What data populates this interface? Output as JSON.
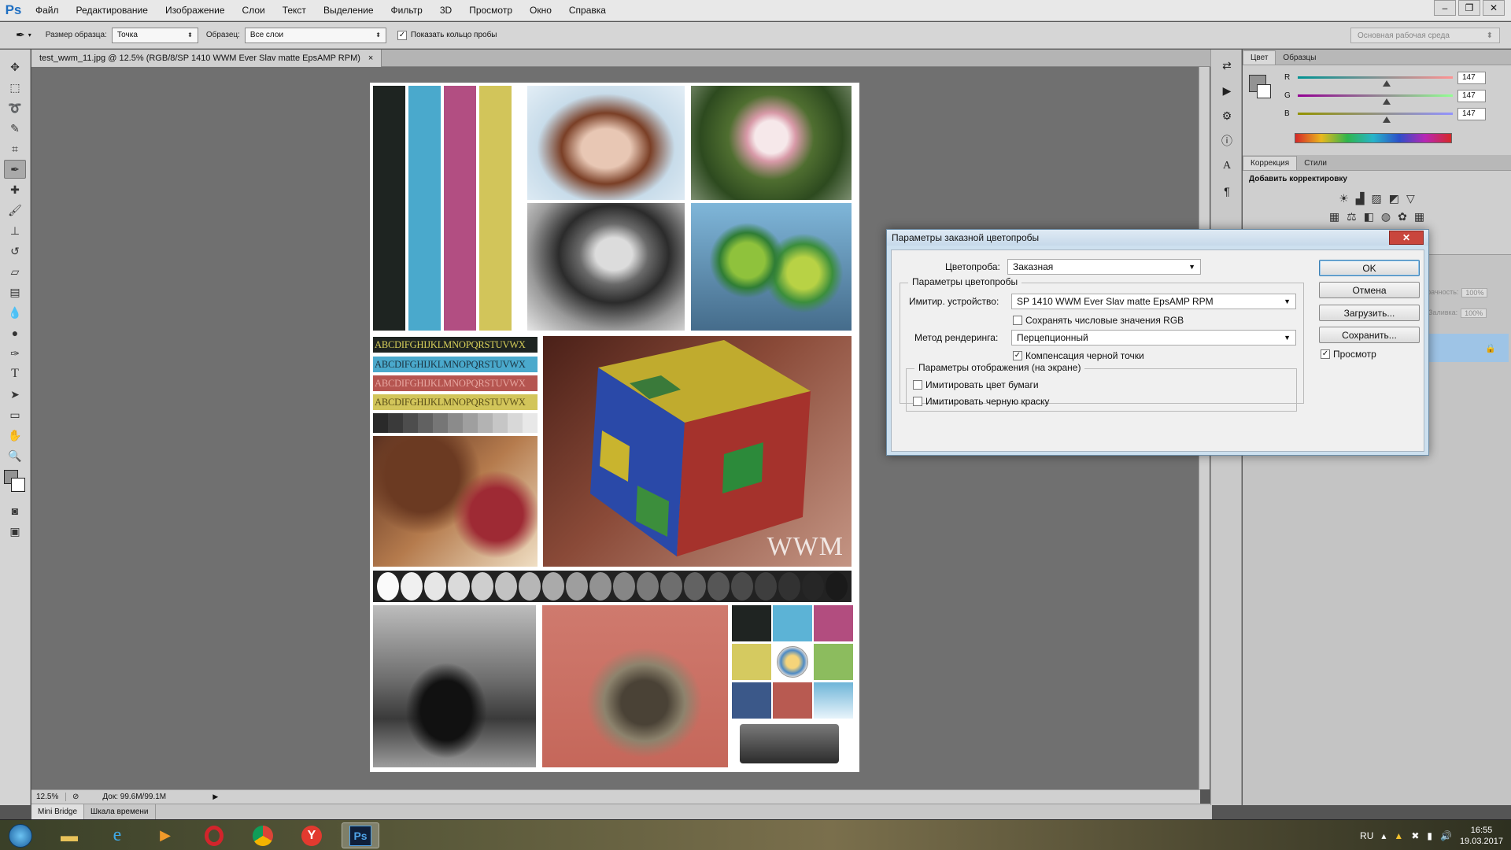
{
  "app": {
    "logo": "Ps",
    "menu": [
      "Файл",
      "Редактирование",
      "Изображение",
      "Слои",
      "Текст",
      "Выделение",
      "Фильтр",
      "3D",
      "Просмотр",
      "Окно",
      "Справка"
    ],
    "window_controls": [
      "–",
      "❐",
      "✕"
    ]
  },
  "options_bar": {
    "sample_size_label": "Размер образца:",
    "sample_size_value": "Точка",
    "sample_label": "Образец:",
    "sample_value": "Все слои",
    "show_ring_label": "Показать кольцо пробы",
    "show_ring_checked": true,
    "workspace": "Основная рабочая среда"
  },
  "document": {
    "tab_title": "test_wwm_11.jpg @ 12.5% (RGB/8/SP 1410 WWM Ever  Slav matte  EpsAMP RPM)",
    "close": "×",
    "abc_lines": [
      "ABCDIFGHIJKLMNOPQRSTUVWX",
      "ABCDIFGHIJKLMNOPQRSTUVWX",
      "ABCDIFGHIJKLMNOPQRSTUVWX",
      "ABCDIFGHIJKLMNOPQRSTUVWX"
    ],
    "watermark": "WWM",
    "stripe_colors": [
      "#1e2421",
      "#4aa9cc",
      "#b24e82",
      "#d2c55a"
    ],
    "tile_colors": [
      "#1f2422",
      "#5cb3d6",
      "#b24d7f",
      "#d5ca60",
      "#ffffff",
      "#8cbc5e",
      "#3b5889",
      "#b85a51",
      "#a5d4ea"
    ]
  },
  "status": {
    "zoom": "12.5%",
    "doc_size": "Док: 99.6M/99.1M"
  },
  "bottom_tabs": [
    "Mini Bridge",
    "Шкала времени"
  ],
  "color_panel": {
    "tabs": [
      "Цвет",
      "Образцы"
    ],
    "channels": [
      {
        "label": "R",
        "value": "147",
        "pct": 0.576
      },
      {
        "label": "G",
        "value": "147",
        "pct": 0.576
      },
      {
        "label": "B",
        "value": "147",
        "pct": 0.576
      }
    ],
    "swatch": "#939393"
  },
  "adjust_panel": {
    "tabs": [
      "Коррекция",
      "Стили"
    ],
    "heading": "Добавить корректировку"
  },
  "layers_panel": {
    "opacity_label": "зрачность:",
    "opacity_value": "100%",
    "fill_label": "Заливка:",
    "fill_value": "100%"
  },
  "dialog": {
    "title": "Параметры заказной цветопробы",
    "close": "✕",
    "proof_label": "Цветопроба:",
    "proof_value": "Заказная",
    "group_title": "Параметры цветопробы",
    "device_label": "Имитир. устройство:",
    "device_value": "SP 1410 WWM Ever  Slav matte  EpsAMP RPM",
    "preserve_rgb": "Сохранять числовые значения RGB",
    "preserve_rgb_checked": false,
    "render_label": "Метод рендеринга:",
    "render_value": "Перцепционный",
    "bpc": "Компенсация черной точки",
    "bpc_checked": true,
    "display_group": "Параметры отображения (на экране)",
    "sim_paper": "Имитировать цвет бумаги",
    "sim_paper_checked": false,
    "sim_ink": "Имитировать черную краску",
    "sim_ink_checked": false,
    "ok": "OK",
    "cancel": "Отмена",
    "load": "Загрузить...",
    "save": "Сохранить...",
    "preview": "Просмотр",
    "preview_checked": true
  },
  "taskbar": {
    "lang": "RU",
    "time": "16:55",
    "date": "19.03.2017"
  }
}
